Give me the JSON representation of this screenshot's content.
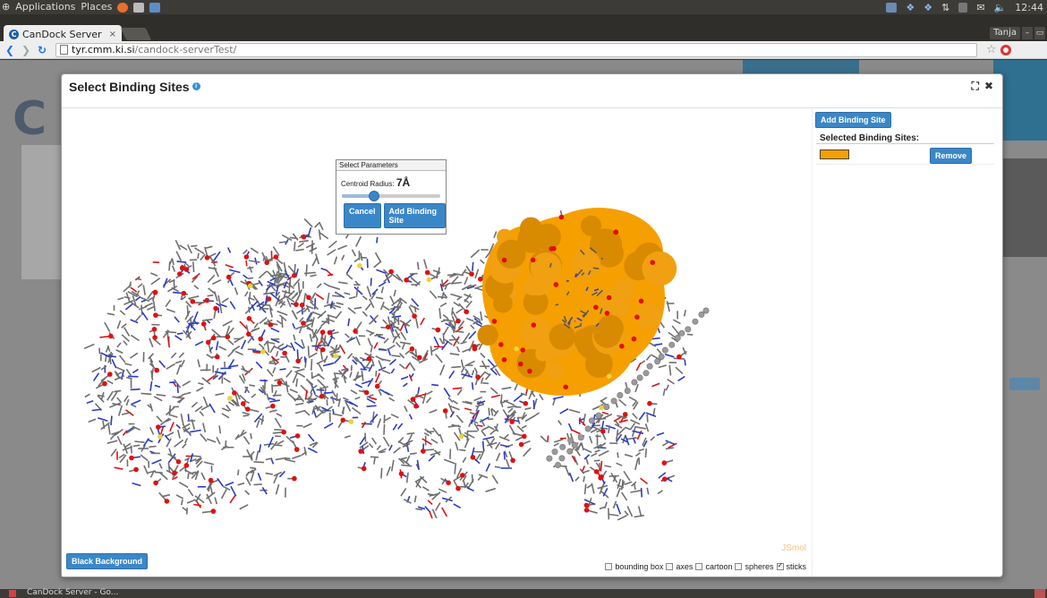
{
  "system_panel": {
    "menus": [
      "Applications",
      "Places"
    ],
    "clock": "12:44"
  },
  "browser": {
    "tab_title": "CanDock Server",
    "tab_close": "×",
    "user": "Tanja",
    "url_host": "tyr.cmm.ki.si",
    "url_path": "/candock-serverTest/"
  },
  "modal": {
    "title": "Select Binding Sites",
    "info_glyph": "i",
    "expand_glyph": "⛶",
    "close_glyph": "✖",
    "black_background_label": "Black Background",
    "jsmol_watermark": "JSmol",
    "view_options": [
      {
        "label": "bounding box",
        "checked": false
      },
      {
        "label": "axes",
        "checked": false
      },
      {
        "label": "cartoon",
        "checked": false
      },
      {
        "label": "spheres",
        "checked": false
      },
      {
        "label": "sticks",
        "checked": true
      }
    ]
  },
  "params_dialog": {
    "title": "Select Parameters",
    "radius_label": "Centroid Radius:",
    "radius_value": "7Å",
    "slider_fraction": 0.33,
    "cancel_label": "Cancel",
    "add_label": "Add Binding Site"
  },
  "right_panel": {
    "add_label": "Add Binding Site",
    "selected_title": "Selected Binding Sites:",
    "sites": [
      {
        "color": "#f5a000",
        "remove_label": "Remove"
      }
    ]
  },
  "taskbar": {
    "item": "CanDock Server - Go..."
  },
  "colors": {
    "accent": "#3a87c8",
    "surface": "#f5a000",
    "oxygen": "#e01010",
    "nitrogen": "#2a3cc8",
    "carbon": "#6f6f6f",
    "sulfur": "#e8d43a"
  }
}
